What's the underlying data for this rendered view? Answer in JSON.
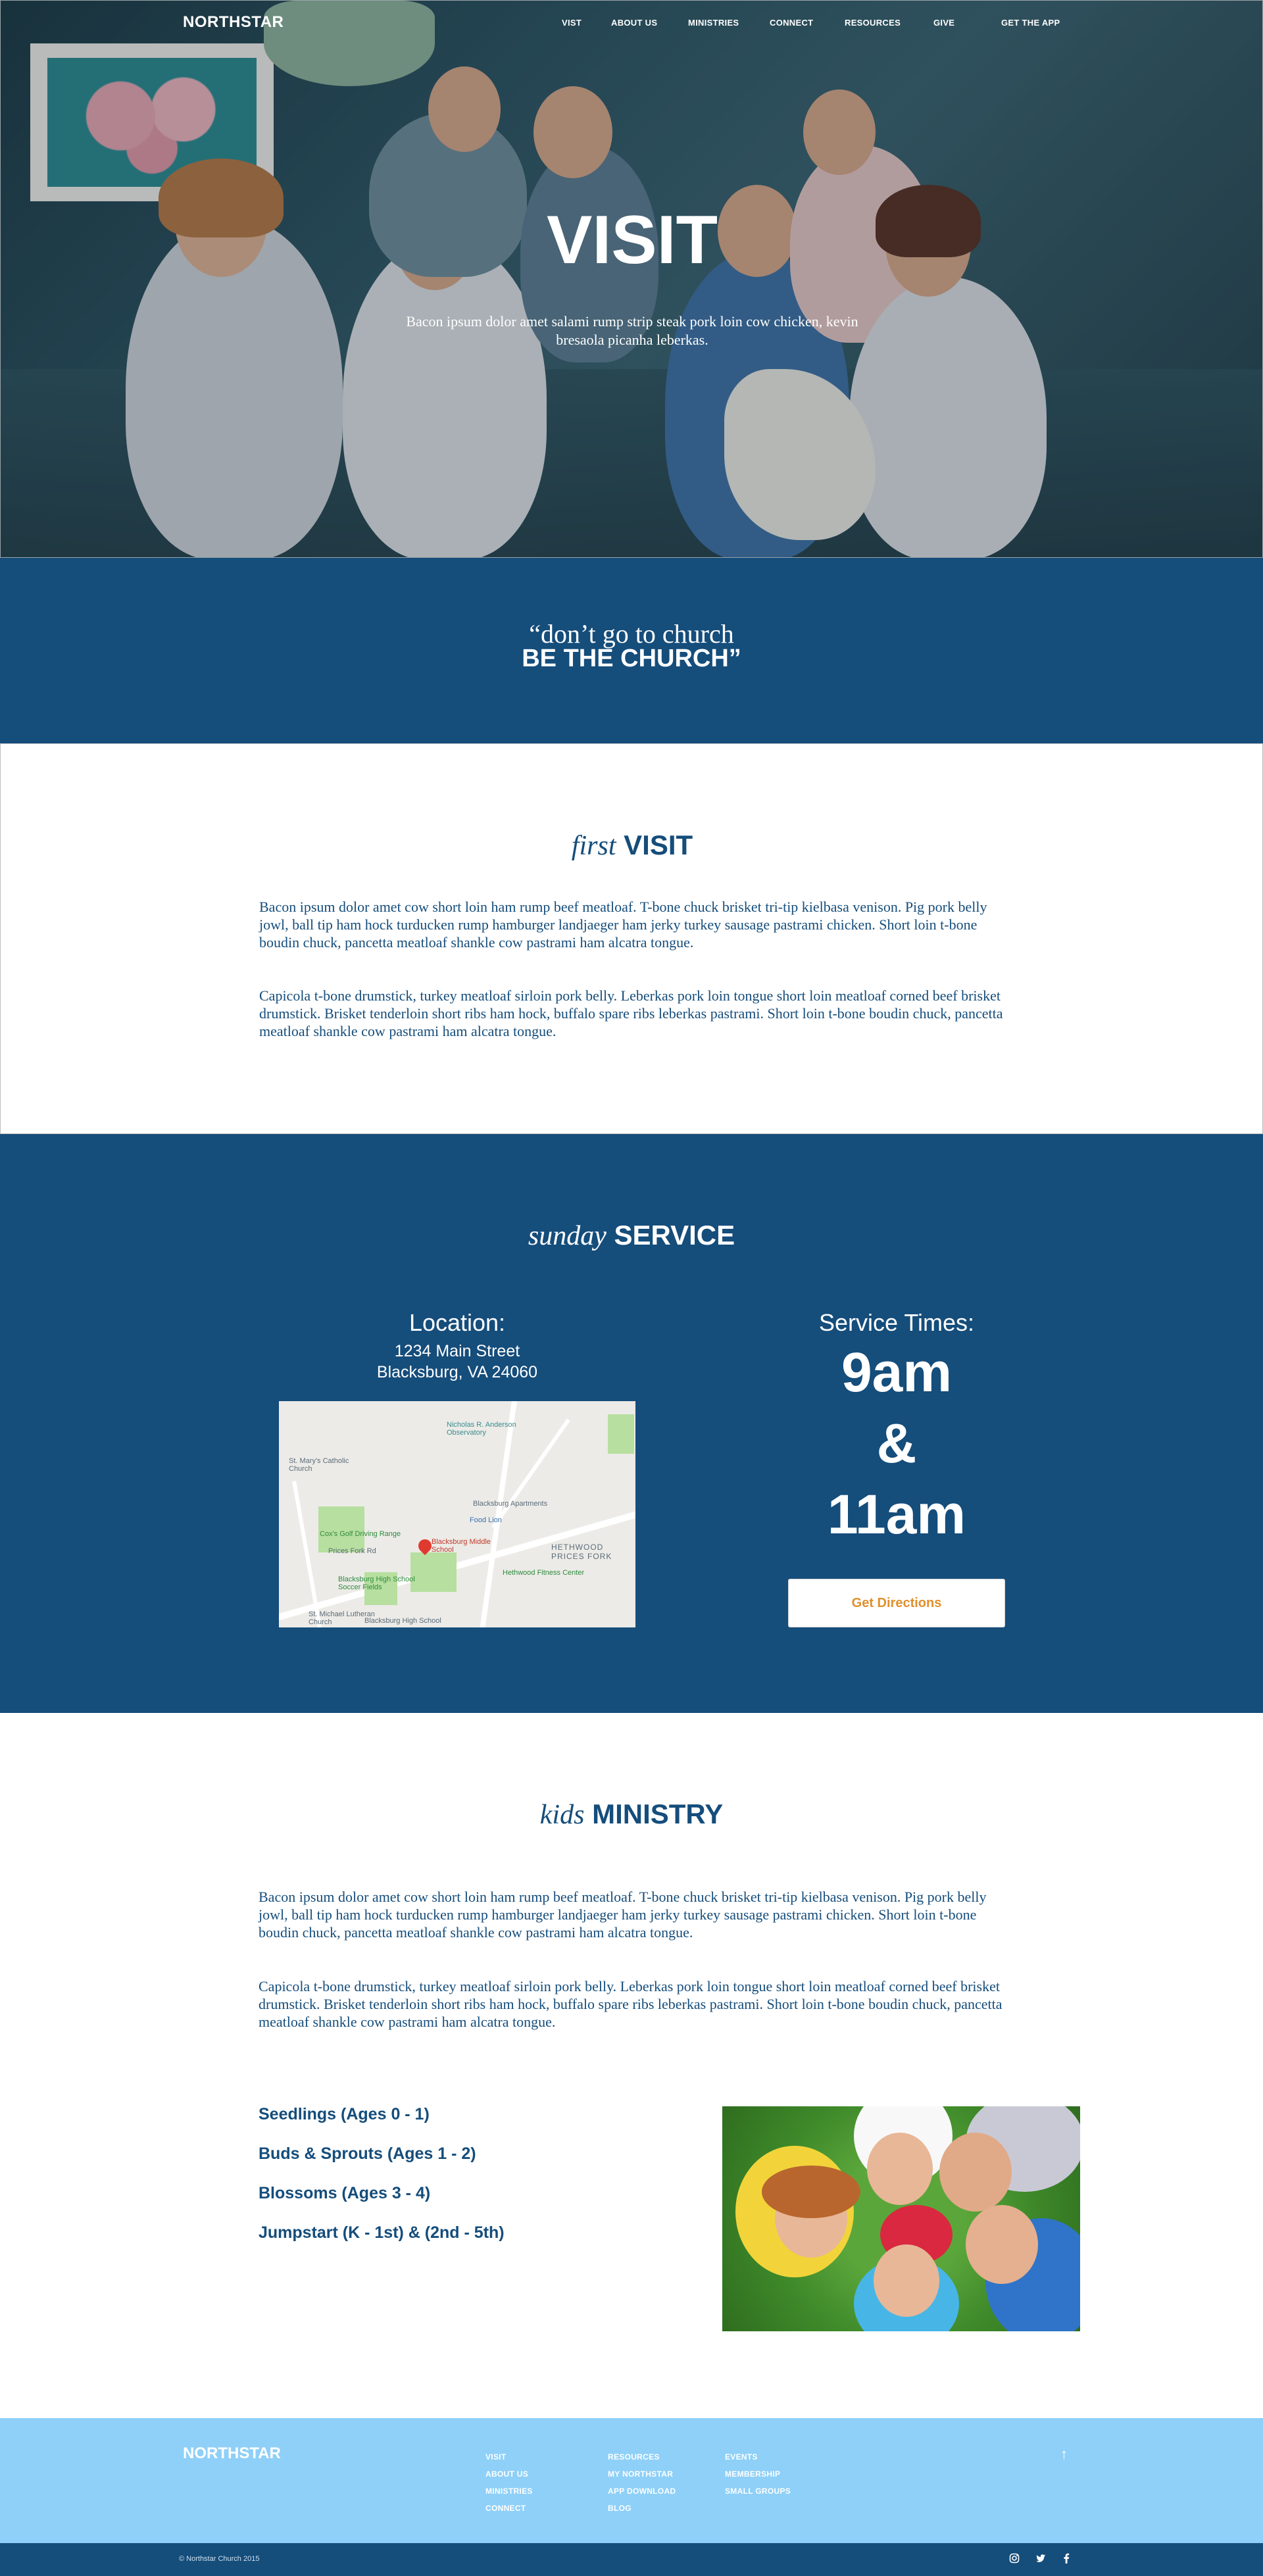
{
  "brand": "NORTHSTAR",
  "nav": {
    "items": [
      "VIST",
      "ABOUT US",
      "MINISTRIES",
      "CONNECT",
      "RESOURCES",
      "GIVE"
    ],
    "cta": "GET THE APP"
  },
  "hero": {
    "title": "VISIT",
    "subtitle": "Bacon ipsum dolor amet salami rump strip steak pork loin cow chicken, kevin bresaola picanha leberkas."
  },
  "quote": {
    "line1": "“don’t go to church",
    "line2": "BE THE CHURCH”"
  },
  "first_visit": {
    "title_italic": "first",
    "title_bold": "VISIT",
    "paragraphs": [
      "Bacon ipsum dolor amet cow short loin ham rump beef meatloaf. T-bone chuck brisket tri-tip kielbasa venison. Pig pork belly jowl, ball tip ham hock turducken rump hamburger landjaeger ham jerky turkey sausage pastrami chicken. Short loin t-bone boudin chuck, pancetta meatloaf shankle cow pastrami ham alcatra tongue.",
      "Capicola t-bone drumstick, turkey meatloaf sirloin pork belly. Leberkas pork loin tongue short loin meatloaf corned beef brisket drumstick. Brisket tenderloin short ribs ham hock, buffalo spare ribs leberkas pastrami. Short loin t-bone boudin chuck, pancetta meatloaf shankle cow pastrami ham alcatra tongue."
    ]
  },
  "service": {
    "title_italic": "sunday",
    "title_bold": "SERVICE",
    "location_label": "Location:",
    "address_line1": "1234 Main Street",
    "address_line2": "Blacksburg, VA 24060",
    "times_label": "Service Times:",
    "time1": "9am",
    "amp": "&",
    "time2": "11am",
    "directions_button": "Get Directions",
    "map_labels": {
      "observatory": "Nicholas R. Anderson Observatory",
      "church": "St. Mary's Catholic Church",
      "apartments": "Blacksburg Apartments",
      "food_lion": "Food Lion",
      "driving_range": "Cox's Golf Driving Range",
      "school": "Blacksburg Middle School",
      "prices_fork": "HETHWOOD PRICES FORK",
      "fitness": "Hethwood Fitness Center",
      "soccer": "Blacksburg High School Soccer Fields",
      "lutheran": "St. Michael Lutheran Church",
      "high_school": "Blacksburg High School",
      "road": "Prices Fork Rd"
    }
  },
  "kids": {
    "title_italic": "kids",
    "title_bold": "MINISTRY",
    "paragraphs": [
      "Bacon ipsum dolor amet cow short loin ham rump beef meatloaf. T-bone chuck brisket tri-tip kielbasa venison. Pig pork belly jowl, ball tip ham hock turducken rump hamburger landjaeger ham jerky turkey sausage pastrami chicken. Short loin t-bone boudin chuck, pancetta meatloaf shankle cow pastrami ham alcatra tongue.",
      "Capicola t-bone drumstick, turkey meatloaf sirloin pork belly. Leberkas pork loin tongue short loin meatloaf corned beef brisket drumstick. Brisket tenderloin short ribs ham hock, buffalo spare ribs leberkas pastrami. Short loin t-bone boudin chuck, pancetta meatloaf shankle cow pastrami ham alcatra tongue."
    ],
    "age_groups": [
      "Seedlings  (Ages 0 - 1)",
      "Buds & Sprouts  (Ages 1 - 2)",
      "Blossoms  (Ages 3 - 4)",
      "Jumpstart  (K - 1st) & (2nd - 5th)"
    ]
  },
  "footer": {
    "brand": "NORTHSTAR",
    "col1": [
      "VISIT",
      "ABOUT US",
      "MINISTRIES",
      "CONNECT"
    ],
    "col2": [
      "RESOURCES",
      "MY NORTHSTAR",
      "APP DOWNLOAD",
      "BLOG"
    ],
    "col3": [
      "EVENTS",
      "MEMBERSHIP",
      "SMALL GROUPS"
    ],
    "copyright": "© Northstar Church 2015",
    "social_icons": [
      "instagram-icon",
      "twitter-icon",
      "facebook-icon"
    ]
  },
  "colors": {
    "primary": "#154d7b",
    "footer_light": "#8ed0f8",
    "button_text": "#e0902d"
  }
}
